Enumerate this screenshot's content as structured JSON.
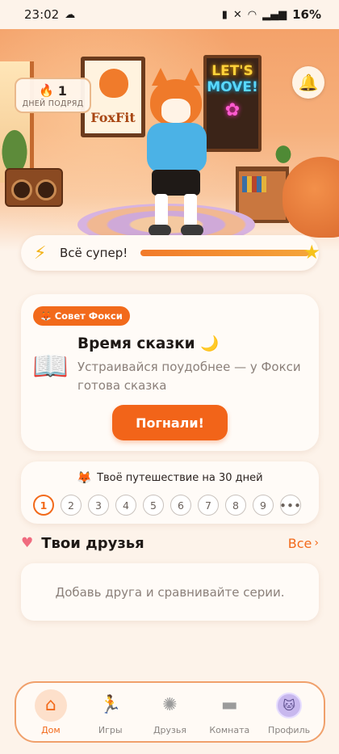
{
  "status_bar": {
    "time": "23:02",
    "battery": "16%",
    "icons": [
      "cloud-icon",
      "battery-saver-icon",
      "mute-icon",
      "wifi-icon",
      "signal-icon"
    ]
  },
  "hero": {
    "streak_count": "1",
    "streak_label": "ДНЕЙ ПОДРЯД",
    "poster_text": "FoxFit",
    "neon_line_1": "LET'S",
    "neon_line_2": "MOVE!"
  },
  "mood": {
    "label": "Всё супер!",
    "level": 1.0
  },
  "tip": {
    "tag": "Совет Фокси",
    "title": "Время сказки",
    "text": "Устраивайся поудобнее — у Фокси готова сказка",
    "button": "Погнали!"
  },
  "journey": {
    "title": "Твоё путешествие на 30 дней",
    "days": [
      "1",
      "2",
      "3",
      "4",
      "5",
      "6",
      "7",
      "8",
      "9"
    ],
    "more": "•••",
    "active_day": "1"
  },
  "friends": {
    "title": "Твои друзья",
    "all_link": "Все",
    "empty_text": "Добавь друга и сравнивайте серии."
  },
  "nav": {
    "items": [
      {
        "label": "Дом",
        "icon": "home-icon",
        "active": true
      },
      {
        "label": "Игры",
        "icon": "games-icon",
        "active": false
      },
      {
        "label": "Друзья",
        "icon": "friends-icon",
        "active": false
      },
      {
        "label": "Комната",
        "icon": "sofa-icon",
        "active": false
      },
      {
        "label": "Профиль",
        "icon": "avatar",
        "active": false
      }
    ]
  },
  "colors": {
    "accent": "#f26a1b",
    "background": "#fdf3ea",
    "star": "#f6c21b"
  }
}
